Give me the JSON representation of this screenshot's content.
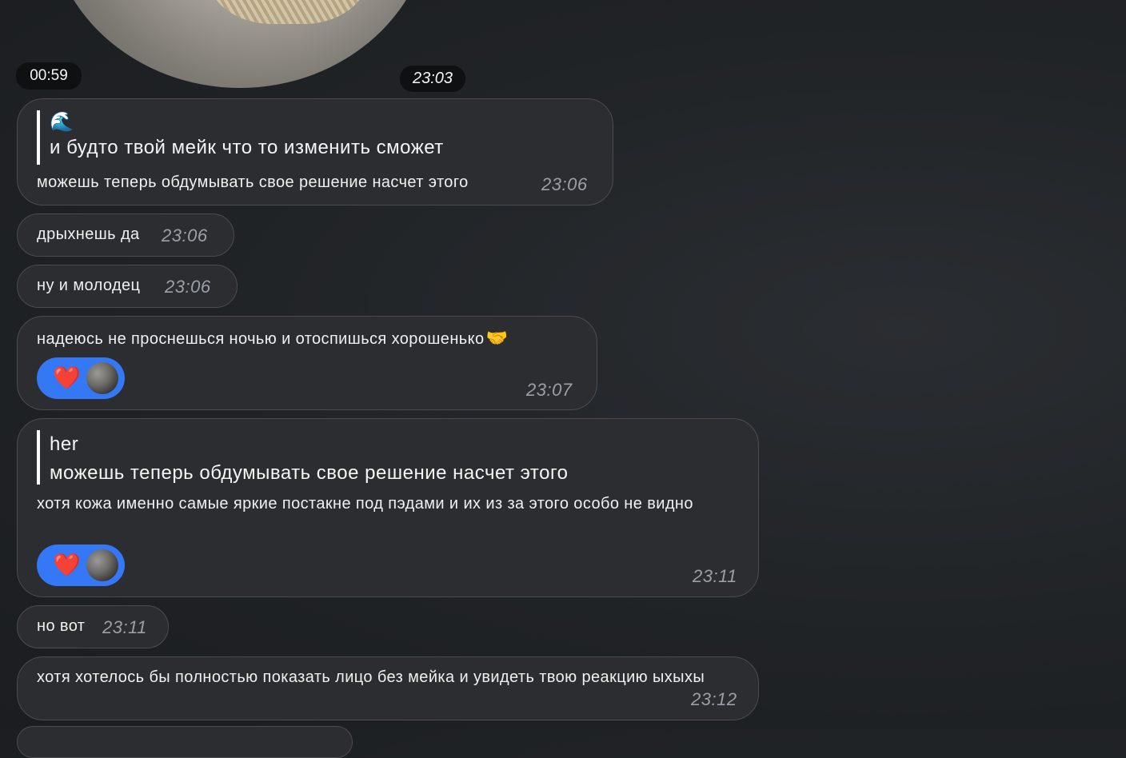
{
  "video_note": {
    "duration": "00:59",
    "time": "23:03"
  },
  "messages": [
    {
      "quote": {
        "emoji": "🌊",
        "text": "и будто твой мейк что то изменить сможет"
      },
      "text": "можешь теперь обдумывать свое решение насчет этого",
      "time": "23:06"
    },
    {
      "text": "дрыхнешь да",
      "time": "23:06"
    },
    {
      "text": "ну и молодец",
      "time": "23:06"
    },
    {
      "text": "надеюсь не проснешься ночью и отоспишься хорошенько",
      "emoji": "🤝",
      "reaction": {
        "emoji": "❤️"
      },
      "time": "23:07"
    },
    {
      "quote": {
        "author": "her",
        "text": "можешь теперь обдумывать свое решение насчет этого"
      },
      "text": "хотя кожа именно самые яркие постакне под пэдами и их из за этого особо не видно",
      "reaction": {
        "emoji": "❤️"
      },
      "time": "23:11"
    },
    {
      "text": "но вот",
      "time": "23:11"
    },
    {
      "text": "хотя хотелось бы полностью показать лицо без мейка и увидеть твою реакцию ыхыхы",
      "time": "23:12"
    }
  ]
}
